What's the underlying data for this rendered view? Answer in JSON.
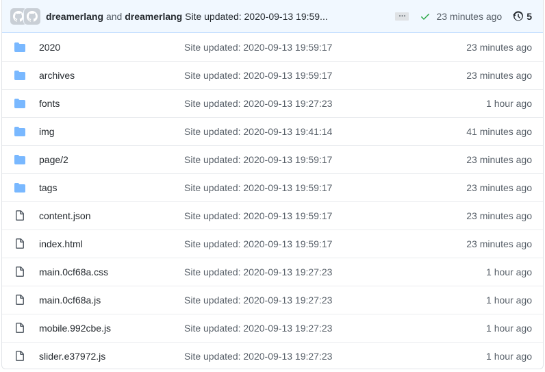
{
  "commit": {
    "author1": "dreamerlang",
    "and_text": "and",
    "author2": "dreamerlang",
    "message": "Site updated: 2020-09-13 19:59...",
    "ellipsis": "…",
    "time_ago": "23 minutes ago",
    "history_count": "5"
  },
  "files": [
    {
      "name": "2020",
      "type": "folder",
      "message": "Site updated: 2020-09-13 19:59:17",
      "age": "23 minutes ago"
    },
    {
      "name": "archives",
      "type": "folder",
      "message": "Site updated: 2020-09-13 19:59:17",
      "age": "23 minutes ago"
    },
    {
      "name": "fonts",
      "type": "folder",
      "message": "Site updated: 2020-09-13 19:27:23",
      "age": "1 hour ago"
    },
    {
      "name": "img",
      "type": "folder",
      "message": "Site updated: 2020-09-13 19:41:14",
      "age": "41 minutes ago"
    },
    {
      "name": "page/2",
      "type": "folder",
      "message": "Site updated: 2020-09-13 19:59:17",
      "age": "23 minutes ago"
    },
    {
      "name": "tags",
      "type": "folder",
      "message": "Site updated: 2020-09-13 19:59:17",
      "age": "23 minutes ago"
    },
    {
      "name": "content.json",
      "type": "file",
      "message": "Site updated: 2020-09-13 19:59:17",
      "age": "23 minutes ago"
    },
    {
      "name": "index.html",
      "type": "file",
      "message": "Site updated: 2020-09-13 19:59:17",
      "age": "23 minutes ago"
    },
    {
      "name": "main.0cf68a.css",
      "type": "file",
      "message": "Site updated: 2020-09-13 19:27:23",
      "age": "1 hour ago"
    },
    {
      "name": "main.0cf68a.js",
      "type": "file",
      "message": "Site updated: 2020-09-13 19:27:23",
      "age": "1 hour ago"
    },
    {
      "name": "mobile.992cbe.js",
      "type": "file",
      "message": "Site updated: 2020-09-13 19:27:23",
      "age": "1 hour ago"
    },
    {
      "name": "slider.e37972.js",
      "type": "file",
      "message": "Site updated: 2020-09-13 19:27:23",
      "age": "1 hour ago"
    }
  ],
  "colors": {
    "folder": "#79b8ff",
    "check": "#28a745",
    "header_bg": "#f1f8ff"
  }
}
